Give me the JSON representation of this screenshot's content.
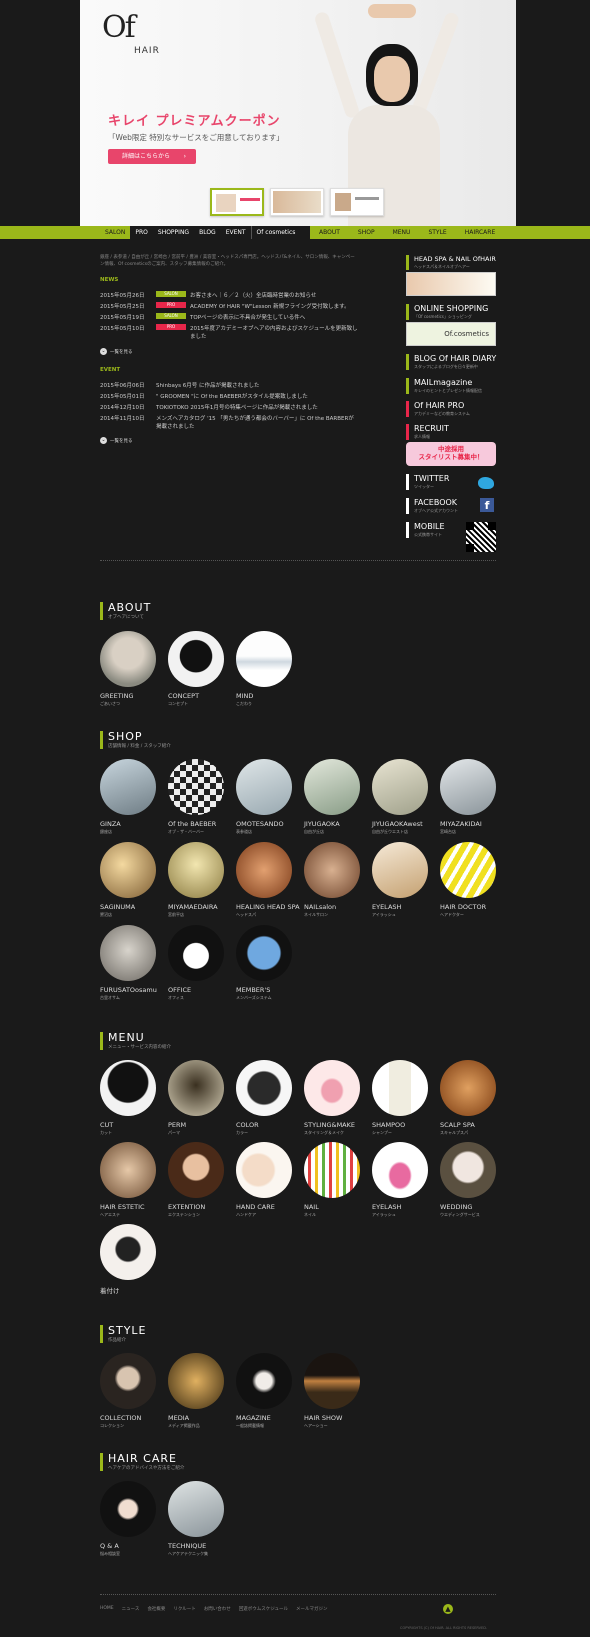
{
  "colors": {
    "accent": "#9bb81a",
    "pink": "#e8456b",
    "red": "#e8264a",
    "bg": "#1a1a1a"
  },
  "hero": {
    "logo_of": "Of",
    "logo_hair": "HAIR",
    "title": "キレイ プレミアムクーポン",
    "subtitle": "「Web限定 特別なサービスをご用意しております」",
    "button": "詳細はこちらから"
  },
  "nav": {
    "left": [
      "SALON",
      "PRO",
      "SHOPPING",
      "BLOG",
      "EVENT",
      "Of cosmetics"
    ],
    "right": [
      "ABOUT",
      "SHOP",
      "MENU",
      "STYLE",
      "HAIRCARE"
    ]
  },
  "intro": "銀座 / 表参道 / 自由が丘 / 宮崎台 / 宮前平 / 豊洲 / 美容室・ヘッドスパ専門店。ヘッドスパ&ネイル、サロン情報、キャンペーン情報、Of cosmeticsのご案内、スタッフ募集情報のご紹介。",
  "news": {
    "label": "NEWS",
    "items": [
      {
        "date": "2015年05月26日",
        "tag": "SALON",
        "text": "お客さまへ｜６／２（火）全店臨時営業のお知らせ"
      },
      {
        "date": "2015年05月25日",
        "tag": "PRO",
        "text": "ACADEMY Of HAIR \"W\"Lesson 新規フライング受付致します。"
      },
      {
        "date": "2015年05月19日",
        "tag": "SALON",
        "text": "TOPページの表示に不具合が発生している件へ"
      },
      {
        "date": "2015年05月10日",
        "tag": "PRO",
        "text": "2015年度アカデミーオブヘアの内容およびスケジュールを更新致しました"
      }
    ],
    "more": "一覧を見る"
  },
  "event": {
    "label": "EVENT",
    "items": [
      {
        "date": "2015年06月06日",
        "text": "Shinbays 6月号 に作品が掲載されました"
      },
      {
        "date": "2015年05月01日",
        "text": "\" GROOMEN \"に Of the BAEBERがスタイル提案致しました"
      },
      {
        "date": "2014年12月10日",
        "text": "TOKIOTOKO 2015年1月号の特集ページに作品が掲載されました"
      },
      {
        "date": "2014年11月10日",
        "text": "メンズヘアカタログ '15 「男たちが通う都会のバーバー」に Of the BARBERが掲載されました"
      }
    ],
    "more": "一覧を見る"
  },
  "sidebar": {
    "headspa": {
      "title": "HEAD SPA & NAIL OfHAIR",
      "sub": "ヘッドスパ＆ネイルオブヘアー"
    },
    "shopping": {
      "title": "ONLINE SHOPPING",
      "sub": "「Of cosmetics」ショッピング",
      "banner": "Of.cosmetics"
    },
    "blog": {
      "title": "BLOG Of HAIR DIARY",
      "sub": "スタッフによるブログを日々更新中"
    },
    "mail": {
      "title": "MAILmagazine",
      "sub": "キレイのヒントとプレゼント情報配信"
    },
    "pro": {
      "title": "Of HAIR PRO",
      "sub": "アカデミーなどの教育システム"
    },
    "recruit": {
      "title": "RECRUIT",
      "sub": "求人情報",
      "banner1": "中途採用",
      "banner2": "スタイリスト募集中！"
    },
    "twitter": {
      "title": "TWITTER",
      "sub": "ツイッター"
    },
    "facebook": {
      "title": "FACEBOOK",
      "sub": "オブヘア公式アカウント"
    },
    "mobile": {
      "title": "MOBILE",
      "sub": "公式携帯サイト"
    }
  },
  "about": {
    "title": "ABOUT",
    "sub": "オブヘアについて",
    "items": [
      {
        "label": "GREETING",
        "jp": "ごあいさつ"
      },
      {
        "label": "CONCEPT",
        "jp": "コンセプト"
      },
      {
        "label": "MIND",
        "jp": "こだわり"
      }
    ]
  },
  "shop": {
    "title": "SHOP",
    "sub": "店舗情報 / 料金 / スタッフ紹介",
    "items": [
      {
        "label": "GINZA",
        "jp": "銀座店"
      },
      {
        "label": "Of the BAEBER",
        "jp": "オブ・ザ・バーバー"
      },
      {
        "label": "OMOTESANDO",
        "jp": "表参道店"
      },
      {
        "label": "JIYUGAOKA",
        "jp": "自由が丘店"
      },
      {
        "label": "JIYUGAOKAwest",
        "jp": "自由が丘ウエスト店"
      },
      {
        "label": "MIYAZAKIDAI",
        "jp": "宮崎台店"
      },
      {
        "label": "SAGINUMA",
        "jp": "鷺沼店"
      },
      {
        "label": "MIYAMAEDAIRA",
        "jp": "宮前平店"
      },
      {
        "label": "HEALING HEAD SPA",
        "jp": "ヘッドスパ"
      },
      {
        "label": "NAILsalon",
        "jp": "ネイルサロン"
      },
      {
        "label": "EYELASH",
        "jp": "アイラッシュ"
      },
      {
        "label": "HAIR DOCTOR",
        "jp": "ヘアドクター"
      },
      {
        "label": "FURUSATOosamu",
        "jp": "古里オサム"
      },
      {
        "label": "OFFICE",
        "jp": "オフィス"
      },
      {
        "label": "MEMBER'S",
        "jp": "メンバーズシステム"
      }
    ]
  },
  "menu": {
    "title": "MENU",
    "sub": "メニュー・サービス内容の紹介",
    "items": [
      {
        "label": "CUT",
        "jp": "カット"
      },
      {
        "label": "PERM",
        "jp": "パーマ"
      },
      {
        "label": "COLOR",
        "jp": "カラー"
      },
      {
        "label": "STYLING&MAKE",
        "jp": "スタイリング＆メイク"
      },
      {
        "label": "SHAMPOO",
        "jp": "シャンプー"
      },
      {
        "label": "SCALP SPA",
        "jp": "スキャルプスパ"
      },
      {
        "label": "HAIR ESTETIC",
        "jp": "ヘアエステ"
      },
      {
        "label": "EXTENTION",
        "jp": "エクステンション"
      },
      {
        "label": "HAND CARE",
        "jp": "ハンドケア"
      },
      {
        "label": "NAIL",
        "jp": "ネイル"
      },
      {
        "label": "EYELASH",
        "jp": "アイラッシュ"
      },
      {
        "label": "WEDDING",
        "jp": "ウエディングサービス"
      },
      {
        "label": "着付け",
        "jp": ""
      }
    ]
  },
  "style": {
    "title": "STYLE",
    "sub": "作品紹介",
    "items": [
      {
        "label": "COLLECTION",
        "jp": "コレクション"
      },
      {
        "label": "MEDIA",
        "jp": "メディア掲載作品"
      },
      {
        "label": "MAGAZINE",
        "jp": "一般誌掲載情報"
      },
      {
        "label": "HAIR SHOW",
        "jp": "ヘアーショー"
      }
    ]
  },
  "haircare": {
    "title": "HAIR CARE",
    "sub": "ヘアケアのアドバイスや方法をご紹介",
    "items": [
      {
        "label": "Q & A",
        "jp": "悩み相談室"
      },
      {
        "label": "TECHNIQUE",
        "jp": "ヘアケアテクニック集"
      }
    ]
  },
  "footer": {
    "links": [
      "HOME",
      "ニュース",
      "会社概要",
      "リクルート",
      "お問い合わせ",
      "回遊ボウムスケジュール",
      "メールマガジン"
    ],
    "top": "▲",
    "copyright": "COPYRIGHTS (C) Of HAIR. ALL RIGHTS RESERVED."
  }
}
